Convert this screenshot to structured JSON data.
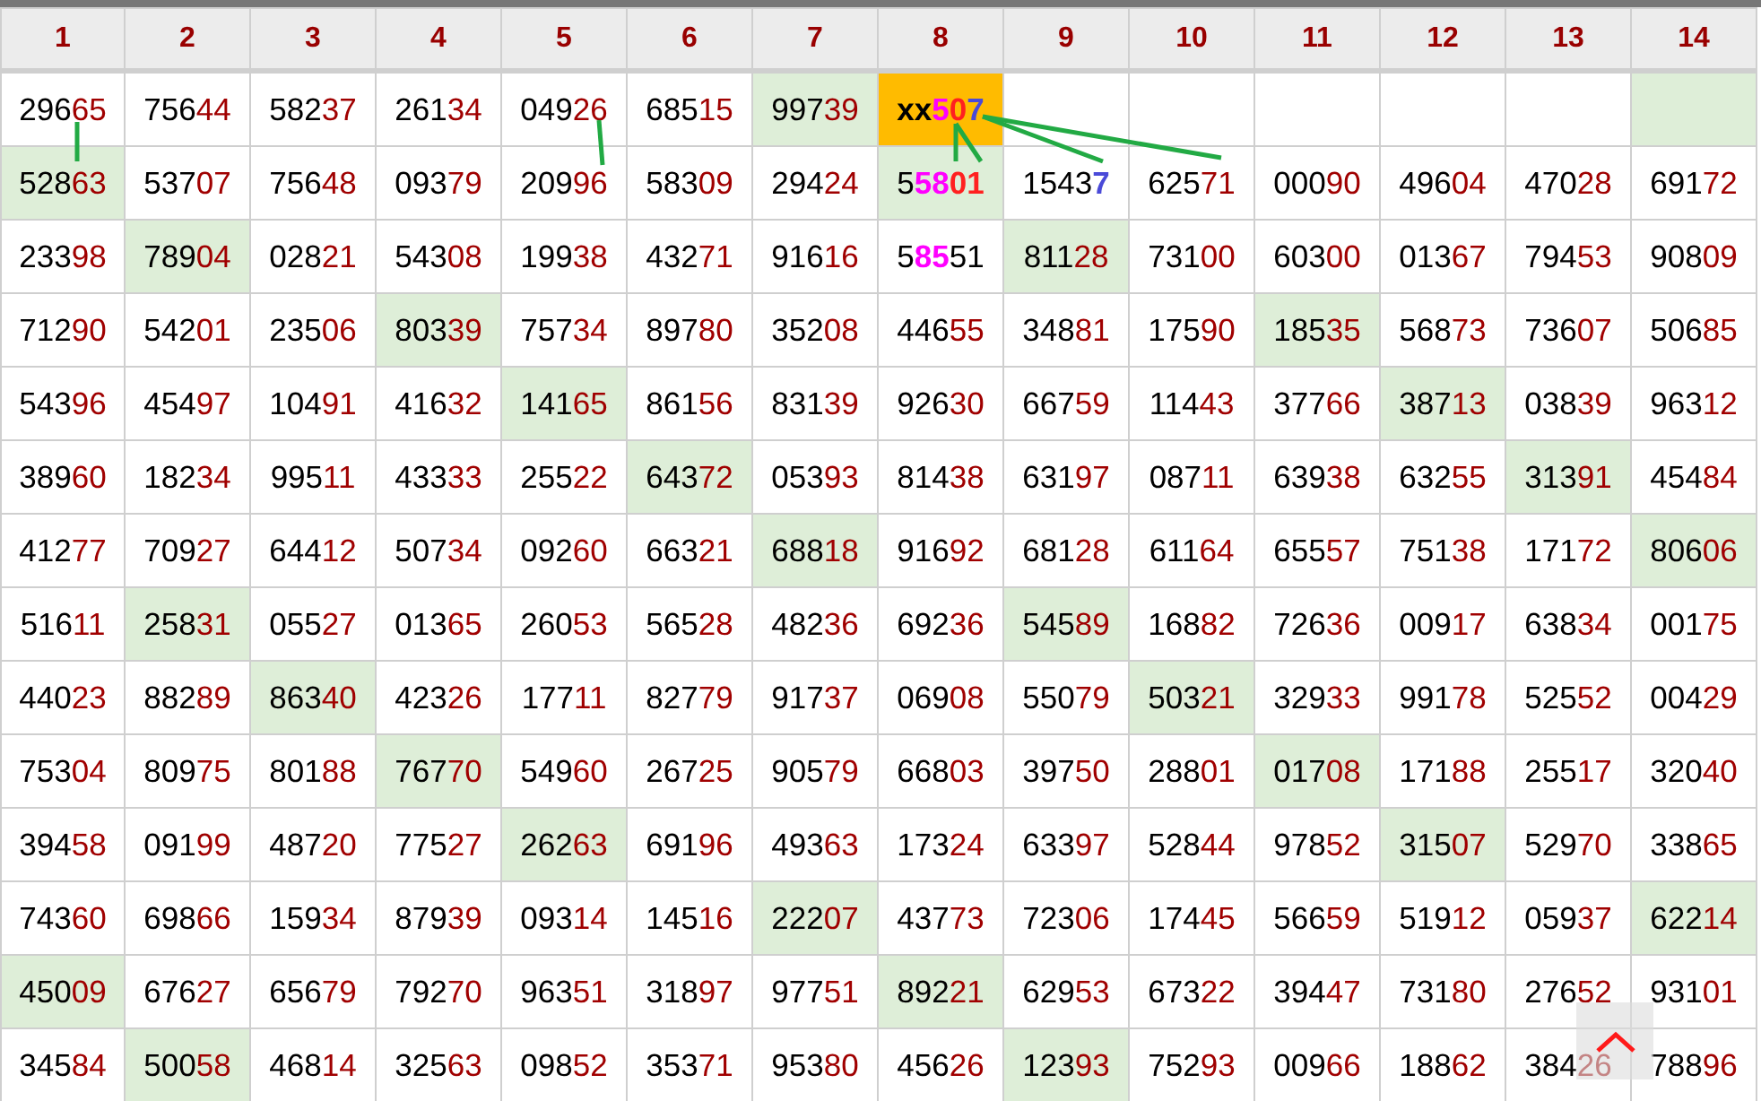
{
  "columns": [
    "1",
    "2",
    "3",
    "4",
    "5",
    "6",
    "7",
    "8",
    "9",
    "10",
    "11",
    "12",
    "13",
    "14"
  ],
  "rows": [
    {
      "cells": [
        {
          "text": "29665",
          "highlighted": false
        },
        {
          "text": "75644",
          "highlighted": false
        },
        {
          "text": "58237",
          "highlighted": false
        },
        {
          "text": "26134",
          "highlighted": false
        },
        {
          "text": "04926",
          "highlighted": false
        },
        {
          "text": "68515",
          "highlighted": false
        },
        {
          "text": "99739",
          "highlighted": true
        },
        {
          "kind": "target",
          "parts": [
            {
              "text": "xx",
              "color": "#000000",
              "bold": true
            },
            {
              "text": "5",
              "color": "#ff00ff",
              "bold": true
            },
            {
              "text": "0",
              "color": "#ff2020",
              "bold": true
            },
            {
              "text": "7",
              "color": "#4a4ad8",
              "bold": true
            }
          ],
          "highlighted": true
        },
        {
          "highlighted": false
        },
        {
          "highlighted": false
        },
        {
          "highlighted": false
        },
        {
          "highlighted": false
        },
        {
          "highlighted": false
        },
        {
          "highlighted": true
        }
      ]
    },
    {
      "cells": [
        {
          "text": "52863",
          "highlighted": true
        },
        {
          "text": "53707",
          "highlighted": false
        },
        {
          "text": "75648",
          "highlighted": false
        },
        {
          "text": "09379",
          "highlighted": false
        },
        {
          "text": "20996",
          "highlighted": false
        },
        {
          "text": "58309",
          "highlighted": false
        },
        {
          "text": "29424",
          "highlighted": false
        },
        {
          "parts": [
            {
              "text": "5",
              "color": "#000000",
              "bold": false
            },
            {
              "text": "58",
              "color": "#ff00ff",
              "bold": true
            },
            {
              "text": "01",
              "color": "#ff2020",
              "bold": true
            }
          ],
          "highlighted": true
        },
        {
          "parts": [
            {
              "text": "1543",
              "color": "#000000",
              "bold": false
            },
            {
              "text": "7",
              "color": "#4a4ad8",
              "bold": true
            }
          ],
          "highlighted": false
        },
        {
          "text": "62571",
          "highlighted": false
        },
        {
          "text": "00090",
          "highlighted": false
        },
        {
          "text": "49604",
          "highlighted": false
        },
        {
          "text": "47028",
          "highlighted": false
        },
        {
          "text": "69172",
          "highlighted": false
        }
      ]
    },
    {
      "cells": [
        {
          "text": "23398",
          "highlighted": false
        },
        {
          "text": "78904",
          "highlighted": true
        },
        {
          "text": "02821",
          "highlighted": false
        },
        {
          "text": "54308",
          "highlighted": false
        },
        {
          "text": "19938",
          "highlighted": false
        },
        {
          "text": "43271",
          "highlighted": false
        },
        {
          "text": "91616",
          "highlighted": false
        },
        {
          "parts": [
            {
              "text": "5",
              "color": "#000000",
              "bold": false
            },
            {
              "text": "85",
              "color": "#ff00ff",
              "bold": true
            },
            {
              "text": "51",
              "color": "#000000",
              "bold": false
            }
          ],
          "highlighted": false
        },
        {
          "text": "81128",
          "highlighted": true
        },
        {
          "text": "73100",
          "highlighted": false
        },
        {
          "text": "60300",
          "highlighted": false
        },
        {
          "text": "01367",
          "highlighted": false
        },
        {
          "text": "79453",
          "highlighted": false
        },
        {
          "text": "90809",
          "highlighted": false
        }
      ]
    },
    {
      "cells": [
        {
          "text": "71290",
          "highlighted": false
        },
        {
          "text": "54201",
          "highlighted": false
        },
        {
          "text": "23506",
          "highlighted": false
        },
        {
          "text": "80339",
          "highlighted": true
        },
        {
          "text": "75734",
          "highlighted": false
        },
        {
          "text": "89780",
          "highlighted": false
        },
        {
          "text": "35208",
          "highlighted": false
        },
        {
          "text": "44655",
          "highlighted": false
        },
        {
          "text": "34881",
          "highlighted": false
        },
        {
          "text": "17590",
          "highlighted": false
        },
        {
          "text": "18535",
          "highlighted": true
        },
        {
          "text": "56873",
          "highlighted": false
        },
        {
          "text": "73607",
          "highlighted": false
        },
        {
          "text": "50685",
          "highlighted": false
        }
      ]
    },
    {
      "cells": [
        {
          "text": "54396",
          "highlighted": false
        },
        {
          "text": "45497",
          "highlighted": false
        },
        {
          "text": "10491",
          "highlighted": false
        },
        {
          "text": "41632",
          "highlighted": false
        },
        {
          "text": "14165",
          "highlighted": true
        },
        {
          "text": "86156",
          "highlighted": false
        },
        {
          "text": "83139",
          "highlighted": false
        },
        {
          "text": "92630",
          "highlighted": false
        },
        {
          "text": "66759",
          "highlighted": false
        },
        {
          "text": "11443",
          "highlighted": false
        },
        {
          "text": "37766",
          "highlighted": false
        },
        {
          "text": "38713",
          "highlighted": true
        },
        {
          "text": "03839",
          "highlighted": false
        },
        {
          "text": "96312",
          "highlighted": false
        }
      ]
    },
    {
      "cells": [
        {
          "text": "38960",
          "highlighted": false
        },
        {
          "text": "18234",
          "highlighted": false
        },
        {
          "text": "99511",
          "highlighted": false
        },
        {
          "text": "43333",
          "highlighted": false
        },
        {
          "text": "25522",
          "highlighted": false
        },
        {
          "text": "64372",
          "highlighted": true
        },
        {
          "text": "05393",
          "highlighted": false
        },
        {
          "text": "81438",
          "highlighted": false
        },
        {
          "text": "63197",
          "highlighted": false
        },
        {
          "text": "08711",
          "highlighted": false
        },
        {
          "text": "63938",
          "highlighted": false
        },
        {
          "text": "63255",
          "highlighted": false
        },
        {
          "text": "31391",
          "highlighted": true
        },
        {
          "text": "45484",
          "highlighted": false
        }
      ]
    },
    {
      "cells": [
        {
          "text": "41277",
          "highlighted": false
        },
        {
          "text": "70927",
          "highlighted": false
        },
        {
          "text": "64412",
          "highlighted": false
        },
        {
          "text": "50734",
          "highlighted": false
        },
        {
          "text": "09260",
          "highlighted": false
        },
        {
          "text": "66321",
          "highlighted": false
        },
        {
          "text": "68818",
          "highlighted": true
        },
        {
          "text": "91692",
          "highlighted": false
        },
        {
          "text": "68128",
          "highlighted": false
        },
        {
          "text": "61164",
          "highlighted": false
        },
        {
          "text": "65557",
          "highlighted": false
        },
        {
          "text": "75138",
          "highlighted": false
        },
        {
          "text": "17172",
          "highlighted": false
        },
        {
          "text": "80606",
          "highlighted": true
        }
      ]
    },
    {
      "cells": [
        {
          "text": "51611",
          "highlighted": false
        },
        {
          "text": "25831",
          "highlighted": true
        },
        {
          "text": "05527",
          "highlighted": false
        },
        {
          "text": "01365",
          "highlighted": false
        },
        {
          "text": "26053",
          "highlighted": false
        },
        {
          "text": "56528",
          "highlighted": false
        },
        {
          "text": "48236",
          "highlighted": false
        },
        {
          "text": "69236",
          "highlighted": false
        },
        {
          "text": "54589",
          "highlighted": true
        },
        {
          "text": "16882",
          "highlighted": false
        },
        {
          "text": "72636",
          "highlighted": false
        },
        {
          "text": "00917",
          "highlighted": false
        },
        {
          "text": "63834",
          "highlighted": false
        },
        {
          "text": "00175",
          "highlighted": false
        }
      ]
    },
    {
      "cells": [
        {
          "text": "44023",
          "highlighted": false
        },
        {
          "text": "88289",
          "highlighted": false
        },
        {
          "text": "86340",
          "highlighted": true
        },
        {
          "text": "42326",
          "highlighted": false
        },
        {
          "text": "17711",
          "highlighted": false
        },
        {
          "text": "82779",
          "highlighted": false
        },
        {
          "text": "91737",
          "highlighted": false
        },
        {
          "text": "06908",
          "highlighted": false
        },
        {
          "text": "55079",
          "highlighted": false
        },
        {
          "text": "50321",
          "highlighted": true
        },
        {
          "text": "32933",
          "highlighted": false
        },
        {
          "text": "99178",
          "highlighted": false
        },
        {
          "text": "52552",
          "highlighted": false
        },
        {
          "text": "00429",
          "highlighted": false
        }
      ]
    },
    {
      "cells": [
        {
          "text": "75304",
          "highlighted": false
        },
        {
          "text": "80975",
          "highlighted": false
        },
        {
          "text": "80188",
          "highlighted": false
        },
        {
          "text": "76770",
          "highlighted": true
        },
        {
          "text": "54960",
          "highlighted": false
        },
        {
          "text": "26725",
          "highlighted": false
        },
        {
          "text": "90579",
          "highlighted": false
        },
        {
          "text": "66803",
          "highlighted": false
        },
        {
          "text": "39750",
          "highlighted": false
        },
        {
          "text": "28801",
          "highlighted": false
        },
        {
          "text": "01708",
          "highlighted": true
        },
        {
          "text": "17188",
          "highlighted": false
        },
        {
          "text": "25517",
          "highlighted": false
        },
        {
          "text": "32040",
          "highlighted": false
        }
      ]
    },
    {
      "cells": [
        {
          "text": "39458",
          "highlighted": false
        },
        {
          "text": "09199",
          "highlighted": false
        },
        {
          "text": "48720",
          "highlighted": false
        },
        {
          "text": "77527",
          "highlighted": false
        },
        {
          "text": "26263",
          "highlighted": true
        },
        {
          "text": "69196",
          "highlighted": false
        },
        {
          "text": "49363",
          "highlighted": false
        },
        {
          "text": "17324",
          "highlighted": false
        },
        {
          "text": "63397",
          "highlighted": false
        },
        {
          "text": "52844",
          "highlighted": false
        },
        {
          "text": "97852",
          "highlighted": false
        },
        {
          "text": "31507",
          "highlighted": true
        },
        {
          "text": "52970",
          "highlighted": false
        },
        {
          "text": "33865",
          "highlighted": false
        }
      ]
    },
    {
      "cells": [
        {
          "text": "74360",
          "highlighted": false
        },
        {
          "text": "69866",
          "highlighted": false
        },
        {
          "text": "15934",
          "highlighted": false
        },
        {
          "text": "87939",
          "highlighted": false
        },
        {
          "text": "09314",
          "highlighted": false
        },
        {
          "text": "14516",
          "highlighted": false
        },
        {
          "text": "22207",
          "highlighted": true
        },
        {
          "text": "43773",
          "highlighted": false
        },
        {
          "text": "72306",
          "highlighted": false
        },
        {
          "text": "17445",
          "highlighted": false
        },
        {
          "text": "56659",
          "highlighted": false
        },
        {
          "text": "51912",
          "highlighted": false
        },
        {
          "text": "05937",
          "highlighted": false
        },
        {
          "text": "62214",
          "highlighted": true
        }
      ]
    },
    {
      "cells": [
        {
          "text": "45009",
          "highlighted": true
        },
        {
          "text": "67627",
          "highlighted": false
        },
        {
          "text": "65679",
          "highlighted": false
        },
        {
          "text": "79270",
          "highlighted": false
        },
        {
          "text": "96351",
          "highlighted": false
        },
        {
          "text": "31897",
          "highlighted": false
        },
        {
          "text": "97751",
          "highlighted": false
        },
        {
          "text": "89221",
          "highlighted": true
        },
        {
          "text": "62953",
          "highlighted": false
        },
        {
          "text": "67322",
          "highlighted": false
        },
        {
          "text": "39447",
          "highlighted": false
        },
        {
          "text": "73180",
          "highlighted": false
        },
        {
          "text": "27652",
          "highlighted": false
        },
        {
          "text": "93101",
          "highlighted": false
        }
      ]
    },
    {
      "cells": [
        {
          "text": "34584",
          "highlighted": false
        },
        {
          "text": "50058",
          "highlighted": true
        },
        {
          "text": "46814",
          "highlighted": false
        },
        {
          "text": "32563",
          "highlighted": false
        },
        {
          "text": "09852",
          "highlighted": false
        },
        {
          "text": "35371",
          "highlighted": false
        },
        {
          "text": "95380",
          "highlighted": false
        },
        {
          "text": "45626",
          "highlighted": false
        },
        {
          "text": "12393",
          "highlighted": true
        },
        {
          "text": "75293",
          "highlighted": false
        },
        {
          "text": "00966",
          "highlighted": false
        },
        {
          "text": "18862",
          "highlighted": false
        },
        {
          "text": "38426",
          "highlighted": false
        },
        {
          "text": "78896",
          "highlighted": false
        }
      ]
    }
  ]
}
